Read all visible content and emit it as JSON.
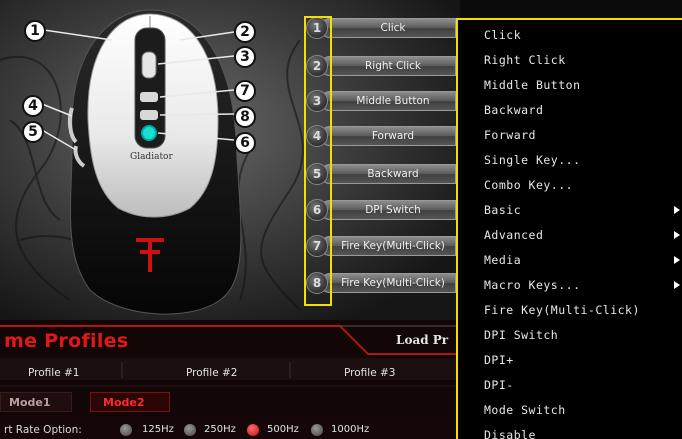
{
  "callouts": [
    "1",
    "2",
    "3",
    "4",
    "5",
    "6",
    "7",
    "8"
  ],
  "mouse_brand": "Gladiator",
  "button_list": [
    {
      "num": "1",
      "label": "Click"
    },
    {
      "num": "2",
      "label": "Right Click"
    },
    {
      "num": "3",
      "label": "Middle Button"
    },
    {
      "num": "4",
      "label": "Forward"
    },
    {
      "num": "5",
      "label": "Backward"
    },
    {
      "num": "6",
      "label": "DPI Switch"
    },
    {
      "num": "7",
      "label": "Fire Key(Multi-Click)"
    },
    {
      "num": "8",
      "label": "Fire Key(Multi-Click)"
    }
  ],
  "menu": {
    "items": [
      {
        "label": "Click",
        "submenu": false
      },
      {
        "label": "Right Click",
        "submenu": false
      },
      {
        "label": "Middle Button",
        "submenu": false
      },
      {
        "label": "Backward",
        "submenu": false
      },
      {
        "label": "Forward",
        "submenu": false
      },
      {
        "label": "Single Key...",
        "submenu": false
      },
      {
        "label": "Combo Key...",
        "submenu": false
      },
      {
        "label": "Basic",
        "submenu": true
      },
      {
        "label": "Advanced",
        "submenu": true
      },
      {
        "label": "Media",
        "submenu": true
      },
      {
        "label": "Macro Keys...",
        "submenu": true
      },
      {
        "label": "Fire Key(Multi-Click)",
        "submenu": false
      },
      {
        "label": "DPI Switch",
        "submenu": false
      },
      {
        "label": "DPI+",
        "submenu": false
      },
      {
        "label": "DPI-",
        "submenu": false
      },
      {
        "label": "Mode Switch",
        "submenu": false
      },
      {
        "label": "Disable",
        "submenu": false
      }
    ]
  },
  "profiles_panel": {
    "title": "me Profiles",
    "load_button": "Load Pr",
    "tabs": [
      "Profile #1",
      "Profile #2",
      "Profile #3"
    ],
    "modes": [
      {
        "label": "Mode1",
        "active": false
      },
      {
        "label": "Mode2",
        "active": true
      }
    ],
    "port_rate": {
      "label": "rt Rate Option:",
      "options": [
        {
          "label": "125Hz",
          "selected": false
        },
        {
          "label": "250Hz",
          "selected": false
        },
        {
          "label": "500Hz",
          "selected": true
        },
        {
          "label": "1000Hz",
          "selected": false
        }
      ]
    }
  },
  "colors": {
    "highlight_yellow": "#f2e000",
    "brand_red": "#e01818",
    "menu_bg": "#000000"
  }
}
